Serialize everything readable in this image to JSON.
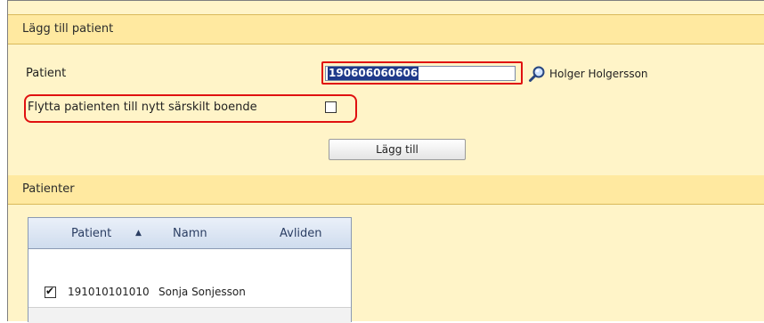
{
  "add_section": {
    "title": "Lägg till patient",
    "patient_label": "Patient",
    "patient_id_value": "190606060606",
    "patient_name": "Holger Holgersson",
    "move_label": "Flytta patienten till nytt särskilt boende",
    "move_checked": false,
    "add_button_label": "Lägg till"
  },
  "patients_section": {
    "title": "Patienter",
    "columns": [
      "Patient",
      "Namn",
      "Avliden"
    ],
    "sorted_column": "Patient",
    "rows": [
      {
        "checked": true,
        "id": "191010101010",
        "name": "Sonja Sonjesson",
        "deceased": ""
      }
    ]
  },
  "colors": {
    "panel_bg": "#fff4c8",
    "header_bg": "#ffe9a0",
    "highlight_box": "#e01010",
    "selection": "#1f3a8a"
  },
  "icons": {
    "search": "magnifier-icon"
  }
}
